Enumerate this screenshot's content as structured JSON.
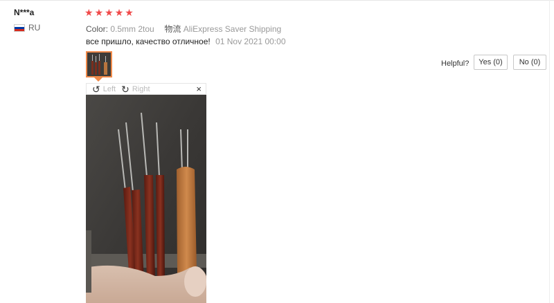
{
  "review": {
    "user_name": "N***a",
    "country_code": "RU",
    "rating": 5,
    "attributes": {
      "color_label": "Color:",
      "color_value": "0.5mm 2tou",
      "shipping_label": "物流",
      "shipping_value": "AliExpress Saver Shipping"
    },
    "feedback_text": "все пришло, качество отличное!",
    "date": "01 Nov 2021 00:00"
  },
  "viewer": {
    "rotate_left_label": "Left",
    "rotate_right_label": "Right",
    "close_symbol": "×"
  },
  "helpful": {
    "label": "Helpful?",
    "yes_label": "Yes (0)",
    "no_label": "No (0)"
  },
  "icons": {
    "star": "★",
    "rotate_left": "↺",
    "rotate_right": "↻"
  },
  "colors": {
    "star": "#f04a4a",
    "accent_border": "#f08a4a"
  }
}
